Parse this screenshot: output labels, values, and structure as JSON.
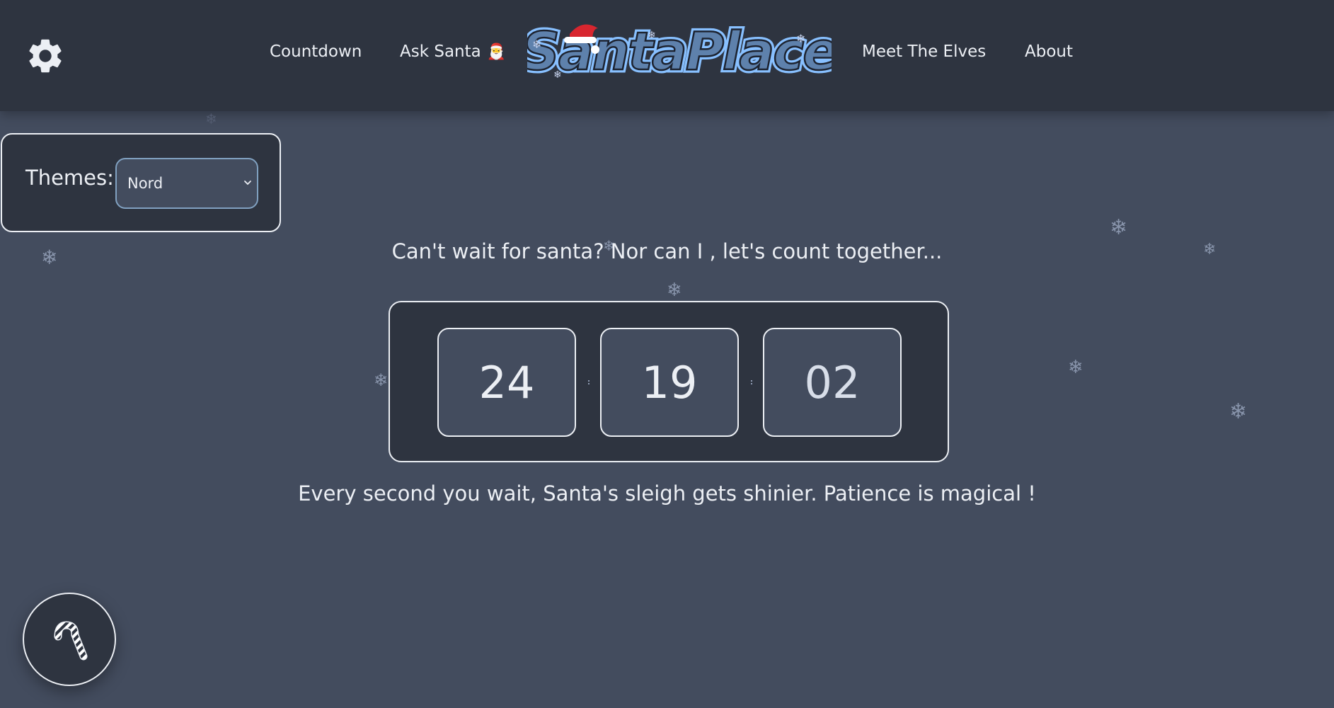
{
  "header": {
    "settings_icon": "gear-icon",
    "nav": {
      "countdown": "Countdown",
      "ask_santa": "Ask Santa",
      "ask_santa_emoji": "🎅",
      "meet_elves": "Meet The Elves",
      "about": "About"
    },
    "logo": {
      "text": "SantaPlace",
      "decoration": "santa-hat-icon"
    }
  },
  "themes": {
    "label": "Themes:",
    "selected": "Nord"
  },
  "countdown": {
    "tagline": "Can't wait for santa? Nor can I , let's count together...",
    "hours": "24",
    "minutes": "19",
    "seconds": "02",
    "subline": "Every second you wait, Santa's sleigh gets shinier. Patience is magical !"
  },
  "fab": {
    "icon": "candy-cane-icon"
  },
  "snowflake_glyph": "❄",
  "colors": {
    "background": "#434c5e",
    "panel": "#2e3440",
    "text": "#eceff4",
    "accent": "#81a1c1",
    "logo_fill": "#5e81ac",
    "logo_outline": "#88c0ff"
  }
}
